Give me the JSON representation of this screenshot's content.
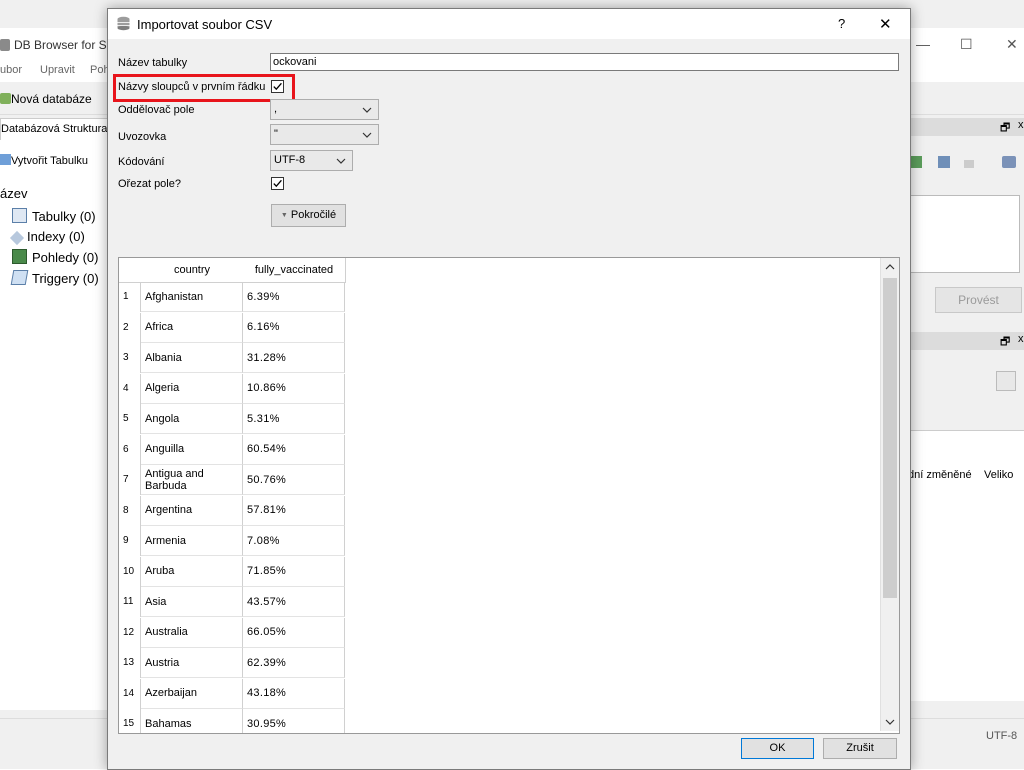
{
  "background_window": {
    "title": "DB Browser for SQ",
    "menu": [
      "ubor",
      "Upravit",
      "Poh"
    ],
    "toolbar_new_db": "Nová databáze",
    "tab_structure": "Databázová Struktura",
    "create_table": "Vytvořit Tabulku",
    "tree_header": "ázev",
    "tree_items": [
      "Tabulky (0)",
      "Indexy (0)",
      "Pohledy (0)",
      "Triggery (0)"
    ],
    "execute_button": "Provést",
    "col_modified": "dní změněné",
    "col_size": "Veliko",
    "status_encoding": "UTF-8"
  },
  "dialog": {
    "title": "Importovat soubor CSV",
    "help_label": "?",
    "close_label": "✕",
    "table_name_label": "Název tabulky",
    "table_name_value": "ockovani",
    "header_row_label": "Názvy sloupců v prvním řádku",
    "header_row_checked": true,
    "field_sep_label": "Oddělovač pole",
    "field_sep_value": ",",
    "quote_label": "Uvozovka",
    "quote_value": "\"",
    "encoding_label": "Kódování",
    "encoding_value": "UTF-8",
    "trim_label": "Ořezat pole?",
    "trim_checked": true,
    "advanced_button": "Pokročilé",
    "ok_button": "OK",
    "cancel_button": "Zrušit",
    "highlight_color": "#e8141b"
  },
  "preview": {
    "columns": [
      "country",
      "fully_vaccinated"
    ],
    "rows": [
      {
        "n": "1",
        "country": "Afghanistan",
        "value": "6.39%"
      },
      {
        "n": "2",
        "country": "Africa",
        "value": "6.16%"
      },
      {
        "n": "3",
        "country": "Albania",
        "value": "31.28%"
      },
      {
        "n": "4",
        "country": "Algeria",
        "value": "10.86%"
      },
      {
        "n": "5",
        "country": "Angola",
        "value": "5.31%"
      },
      {
        "n": "6",
        "country": "Anguilla",
        "value": "60.54%"
      },
      {
        "n": "7",
        "country": "Antigua and Barbuda",
        "value": "50.76%"
      },
      {
        "n": "8",
        "country": "Argentina",
        "value": "57.81%"
      },
      {
        "n": "9",
        "country": "Armenia",
        "value": "7.08%"
      },
      {
        "n": "10",
        "country": "Aruba",
        "value": "71.85%"
      },
      {
        "n": "11",
        "country": "Asia",
        "value": "43.57%"
      },
      {
        "n": "12",
        "country": "Australia",
        "value": "66.05%"
      },
      {
        "n": "13",
        "country": "Austria",
        "value": "62.39%"
      },
      {
        "n": "14",
        "country": "Azerbaijan",
        "value": "43.18%"
      },
      {
        "n": "15",
        "country": "Bahamas",
        "value": "30.95%"
      }
    ]
  }
}
